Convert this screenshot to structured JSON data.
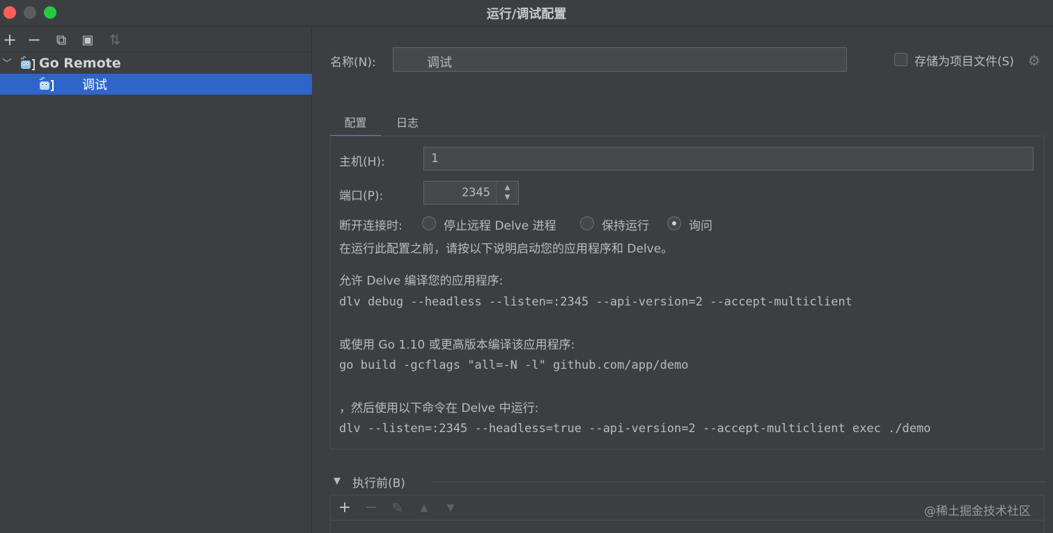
{
  "window": {
    "title": "运行/调试配置"
  },
  "sidebar": {
    "toolbar": [
      {
        "icon": "plus-icon",
        "glyph": "+",
        "enabled": true
      },
      {
        "icon": "minus-icon",
        "glyph": "−",
        "enabled": true
      },
      {
        "icon": "copy-icon",
        "glyph": "⧉",
        "enabled": true
      },
      {
        "icon": "folder-add-icon",
        "glyph": "▣",
        "enabled": true
      },
      {
        "icon": "sort-icon",
        "glyph": "⇅",
        "enabled": false
      }
    ],
    "tree": {
      "group_label": "Go Remote",
      "item_label": "调试"
    }
  },
  "main": {
    "name_label": "名称(N):",
    "name_value": "调试",
    "store_label": "存储为项目文件(S)",
    "tabs": [
      {
        "label": "配置",
        "active": true
      },
      {
        "label": "日志",
        "active": false
      }
    ],
    "host_label": "主机(H):",
    "host_value": "1",
    "port_label": "端口(P):",
    "port_value": "2345",
    "disconnect_label": "断开连接时:",
    "radio_options": [
      {
        "label": "停止远程 Delve 进程",
        "selected": false
      },
      {
        "label": "保持运行",
        "selected": false
      },
      {
        "label": "询问",
        "selected": true
      }
    ],
    "info_text": "在运行此配置之前，请按以下说明启动您的应用程序和 Delve。",
    "allow_text": "允许 Delve 编译您的应用程序:",
    "cmd1": "dlv debug --headless --listen=:2345 --api-version=2 --accept-multiclient",
    "or_text": "或使用 Go 1.10 或更高版本编译该应用程序:",
    "cmd2": "go build -gcflags \"all=-N -l\" github.com/app/demo",
    "then_text": "，然后使用以下命令在 Delve 中运行:",
    "cmd3": "dlv --listen=:2345 --headless=true --api-version=2 --accept-multiclient exec ./demo"
  },
  "before_exec": {
    "label": "执行前(B)",
    "toolbar": [
      {
        "icon": "plus-icon",
        "glyph": "+",
        "enabled": true
      },
      {
        "icon": "minus-icon",
        "glyph": "−",
        "enabled": false
      },
      {
        "icon": "edit-icon",
        "glyph": "✎",
        "enabled": false
      },
      {
        "icon": "move-up-icon",
        "glyph": "▲",
        "enabled": false
      },
      {
        "icon": "move-down-icon",
        "glyph": "▼",
        "enabled": false
      }
    ]
  },
  "watermark": "@稀土掘金技术社区",
  "colors": {
    "selection": "#2f65ca",
    "tab_underline": "#4a88c7",
    "background": "#3c3f41"
  }
}
